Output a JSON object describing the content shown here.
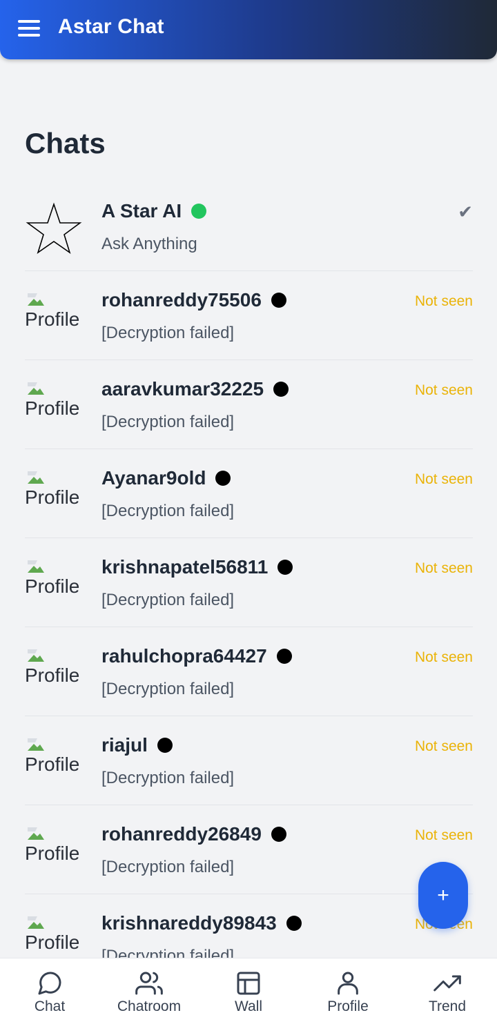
{
  "header": {
    "app_title": "Astar Chat"
  },
  "page": {
    "title": "Chats"
  },
  "chats": [
    {
      "name": "A Star AI",
      "preview": "Ask Anything",
      "status": "✔",
      "online": true,
      "avatar": "star-icon"
    },
    {
      "name": "rohanreddy75506",
      "preview": "[Decryption failed]",
      "status": "Not seen",
      "avatar_alt": "Profile"
    },
    {
      "name": "aaravkumar32225",
      "preview": "[Decryption failed]",
      "status": "Not seen",
      "avatar_alt": "Profile"
    },
    {
      "name": "Ayanar9old",
      "preview": "[Decryption failed]",
      "status": "Not seen",
      "avatar_alt": "Profile"
    },
    {
      "name": "krishnapatel56811",
      "preview": "[Decryption failed]",
      "status": "Not seen",
      "avatar_alt": "Profile"
    },
    {
      "name": "rahulchopra64427",
      "preview": "[Decryption failed]",
      "status": "Not seen",
      "avatar_alt": "Profile"
    },
    {
      "name": "riajul",
      "preview": "[Decryption failed]",
      "status": "Not seen",
      "avatar_alt": "Profile"
    },
    {
      "name": "rohanreddy26849",
      "preview": "[Decryption failed]",
      "status": "Not seen",
      "avatar_alt": "Profile"
    },
    {
      "name": "krishnareddy89843",
      "preview": "[Decryption failed]",
      "status": "Not seen",
      "avatar_alt": "Profile"
    }
  ],
  "fab": {
    "label": "+"
  },
  "bottom_nav": [
    {
      "label": "Chat",
      "icon": "chat-bubble-icon"
    },
    {
      "label": "Chatroom",
      "icon": "users-icon"
    },
    {
      "label": "Wall",
      "icon": "layout-icon"
    },
    {
      "label": "Profile",
      "icon": "user-icon"
    },
    {
      "label": "Trend",
      "icon": "trending-up-icon"
    }
  ],
  "colors": {
    "header_gradient_start": "#2563eb",
    "header_gradient_end": "#1f2937",
    "online_dot": "#22c55e",
    "offline_dot": "#000000",
    "not_seen": "#eab308",
    "fab": "#2563eb"
  }
}
